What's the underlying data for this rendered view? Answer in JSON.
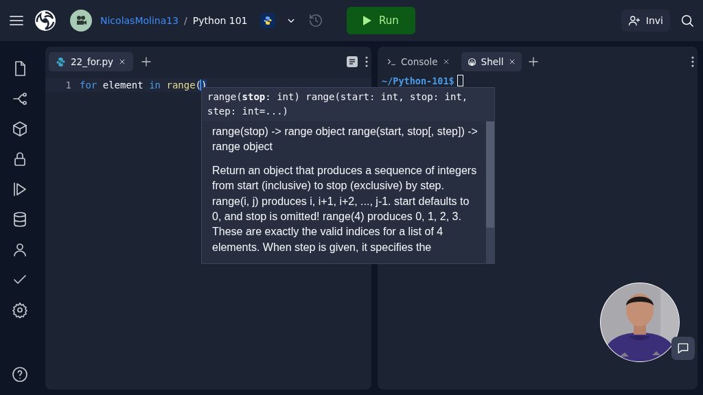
{
  "topbar": {
    "user": "NicolasMolina13",
    "separator": "/",
    "repl": "Python 101",
    "run_label": "Run",
    "invite_label": "Invi"
  },
  "editor": {
    "tabs": [
      {
        "label": "22_for.py",
        "selected": true
      }
    ],
    "lines": [
      {
        "number": "1",
        "tokens": [
          {
            "kind": "keyword",
            "text": "for"
          },
          {
            "kind": "plain",
            "text": " element "
          },
          {
            "kind": "keyword",
            "text": "in "
          },
          {
            "kind": "function",
            "text": "range"
          },
          {
            "kind": "plain",
            "text": "("
          },
          {
            "kind": "plain",
            "text": ")",
            "cursor": true
          }
        ]
      }
    ]
  },
  "tooltip": {
    "signature": "range(**stop**: int) range(start: int, stop: int, step: int=...)",
    "doc": [
      "range(stop) -> range object range(start, stop[, step]) -> range object",
      "Return an object that produces a sequence of integers from start (inclusive) to stop (exclusive) by step.  range(i, j) produces i, i+1, i+2, ..., j-1. start defaults to 0, and stop is omitted!  range(4) produces 0, 1, 2, 3. These are exactly the valid indices for a list of 4 elements. When step is given, it specifies the"
    ]
  },
  "shell": {
    "tabs": [
      {
        "kind": "console",
        "label": "Console",
        "selected": false
      },
      {
        "kind": "shell",
        "label": "Shell",
        "selected": true
      }
    ],
    "prompt": "~/Python-101$"
  }
}
